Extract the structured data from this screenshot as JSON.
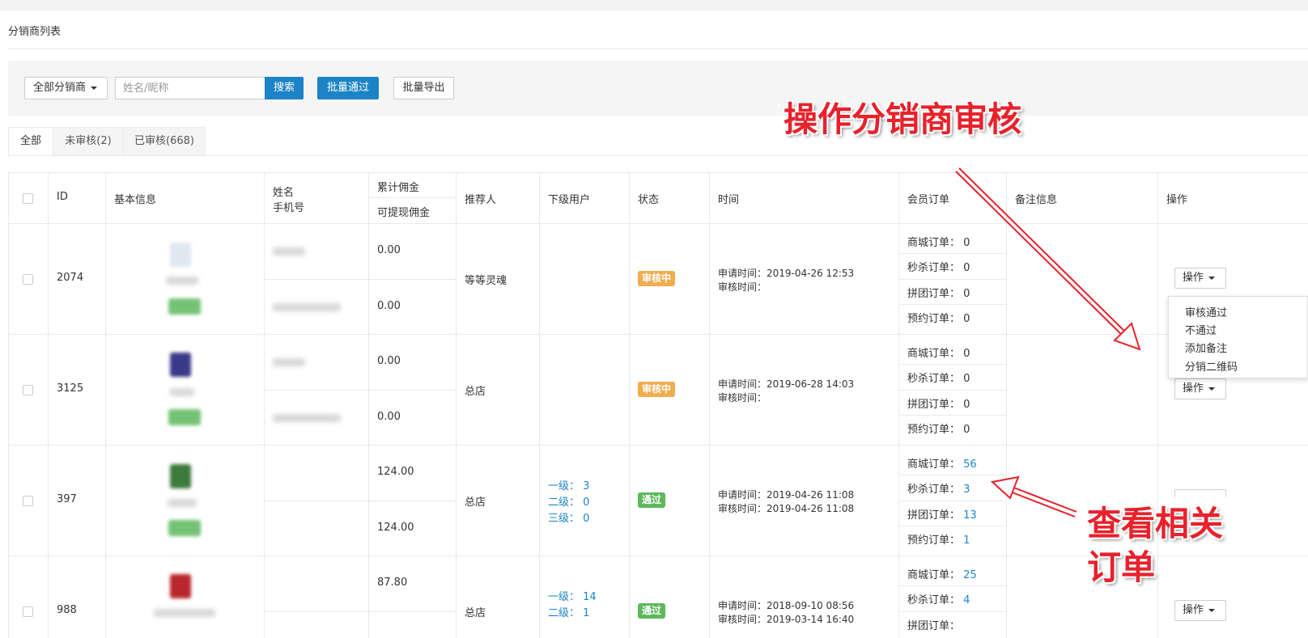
{
  "page_title": "分销商列表",
  "toolbar": {
    "filter_label": "全部分销商",
    "search_placeholder": "姓名/昵称",
    "search_label": "搜索",
    "approve_label": "批量通过",
    "export_label": "批量导出"
  },
  "tabs": [
    {
      "label": "全部",
      "active": true
    },
    {
      "label": "未审核(2)",
      "active": false
    },
    {
      "label": "已审核(668)",
      "active": false
    }
  ],
  "table": {
    "headers": {
      "id": "ID",
      "basic": "基本信息",
      "name": "姓名",
      "phone": "手机号",
      "total_commission": "累计佣金",
      "withdrawable": "可提现佣金",
      "referrer": "推荐人",
      "sub_users": "下级用户",
      "status": "状态",
      "time": "时间",
      "member_orders": "会员订单",
      "remarks": "备注信息",
      "actions": "操作"
    },
    "rows": [
      {
        "id": "2074",
        "total_commission": "0.00",
        "withdrawable": "0.00",
        "referrer": "等等灵魂",
        "sub_users": [],
        "status": "审核中",
        "status_type": "pending",
        "apply_time": "申请时间：2019-04-26 12:53",
        "review_time": "审核时间：",
        "orders": [
          {
            "label": "商城订单：",
            "value": "0"
          },
          {
            "label": "秒杀订单：",
            "value": "0"
          },
          {
            "label": "拼团订单：",
            "value": "0"
          },
          {
            "label": "预约订单：",
            "value": "0"
          }
        ],
        "action_label": "操作"
      },
      {
        "id": "3125",
        "total_commission": "0.00",
        "withdrawable": "0.00",
        "referrer": "总店",
        "sub_users": [],
        "status": "审核中",
        "status_type": "pending",
        "apply_time": "申请时间：2019-06-28 14:03",
        "review_time": "审核时间：",
        "orders": [
          {
            "label": "商城订单：",
            "value": "0"
          },
          {
            "label": "秒杀订单：",
            "value": "0"
          },
          {
            "label": "拼团订单：",
            "value": "0"
          },
          {
            "label": "预约订单：",
            "value": "0"
          }
        ],
        "action_label": "操作"
      },
      {
        "id": "397",
        "total_commission": "124.00",
        "withdrawable": "124.00",
        "referrer": "总店",
        "sub_users": [
          "一级： 3",
          "二级： 0",
          "三级： 0"
        ],
        "status": "通过",
        "status_type": "pass",
        "apply_time": "申请时间：2019-04-26 11:08",
        "review_time": "审核时间：2019-04-26 11:08",
        "orders": [
          {
            "label": "商城订单：",
            "value": "56"
          },
          {
            "label": "秒杀订单：",
            "value": "3"
          },
          {
            "label": "拼团订单：",
            "value": "13"
          },
          {
            "label": "预约订单：",
            "value": "1"
          }
        ],
        "action_label": "操作"
      },
      {
        "id": "988",
        "total_commission": "87.80",
        "withdrawable": "",
        "referrer": "总店",
        "sub_users": [
          "一级： 14",
          "二级： 1"
        ],
        "status": "通过",
        "status_type": "pass",
        "apply_time": "申请时间：2018-09-10 08:56",
        "review_time": "审核时间：2019-03-14 16:40",
        "orders": [
          {
            "label": "商城订单：",
            "value": "25"
          },
          {
            "label": "秒杀订单：",
            "value": "4"
          },
          {
            "label": "拼团订单：",
            "value": ""
          }
        ],
        "action_label": "操作"
      }
    ]
  },
  "action_menu": [
    "审核通过",
    "不通过",
    "添加备注",
    "分销二维码"
  ],
  "annotations": {
    "top": "操作分销商审核",
    "bottom_line1": "查看相关",
    "bottom_line2": "订单"
  },
  "colors": {
    "primary": "#1c84c6",
    "pending": "#f0ad4e",
    "pass": "#5cb85c",
    "annotation": "#e8212b"
  }
}
